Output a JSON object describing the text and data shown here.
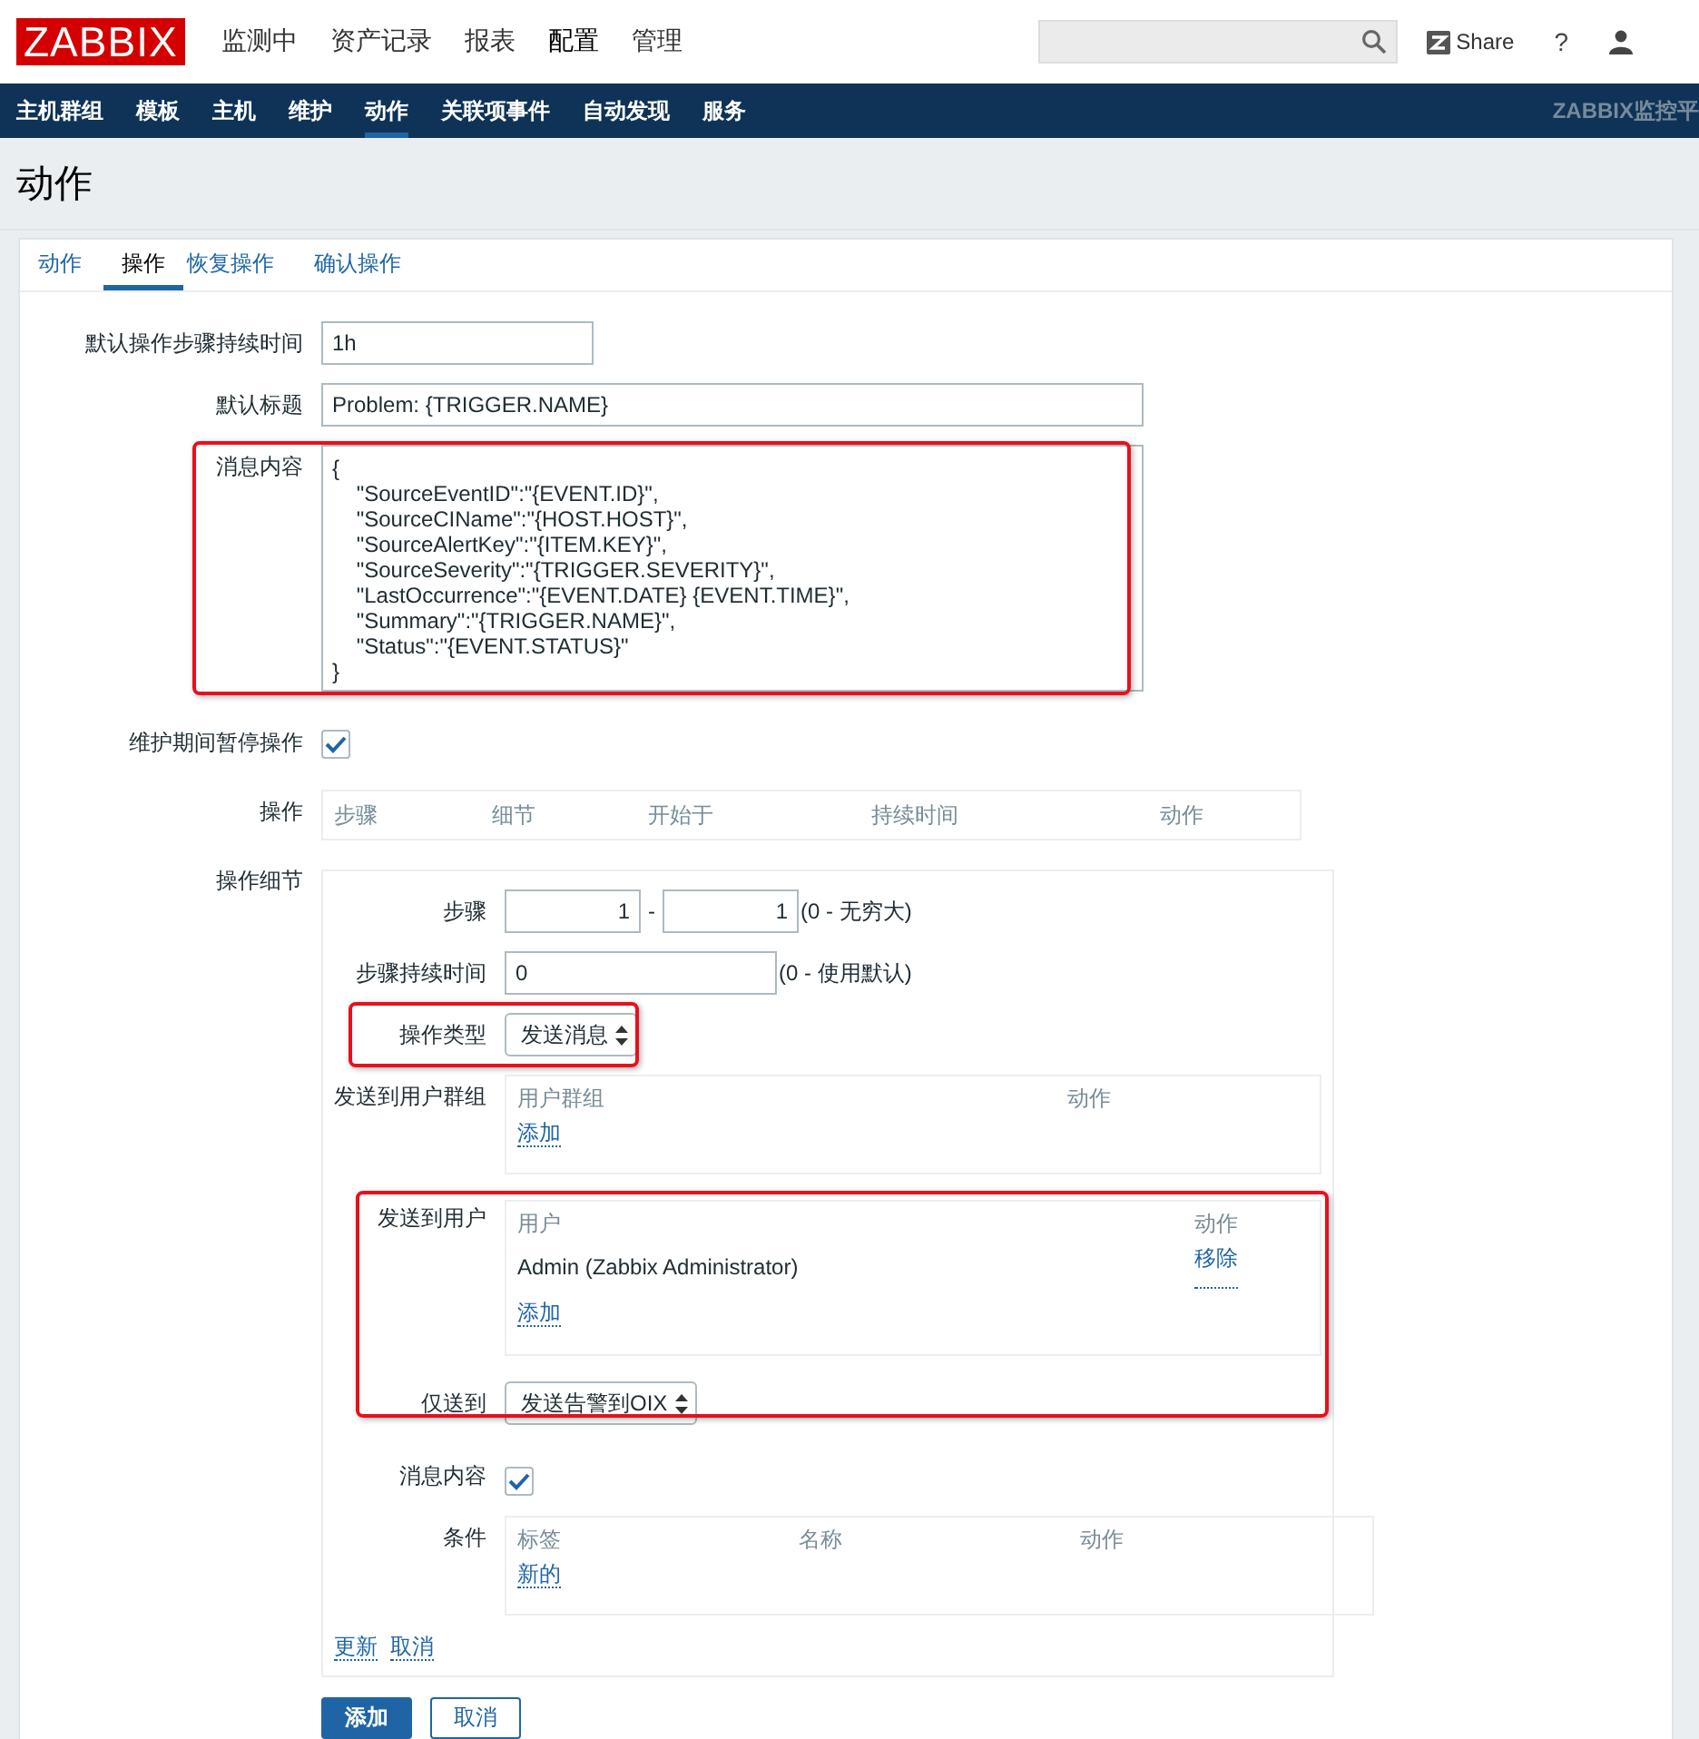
{
  "header": {
    "logo": "ZABBIX",
    "menu": [
      {
        "label": "监测中",
        "selected": false
      },
      {
        "label": "资产记录",
        "selected": false
      },
      {
        "label": "报表",
        "selected": false
      },
      {
        "label": "配置",
        "selected": true
      },
      {
        "label": "管理",
        "selected": false
      }
    ],
    "share": "Share",
    "help": "?"
  },
  "subnav": {
    "items": [
      {
        "label": "主机群组",
        "selected": false
      },
      {
        "label": "模板",
        "selected": false
      },
      {
        "label": "主机",
        "selected": false
      },
      {
        "label": "维护",
        "selected": false
      },
      {
        "label": "动作",
        "selected": true
      },
      {
        "label": "关联项事件",
        "selected": false
      },
      {
        "label": "自动发现",
        "selected": false
      },
      {
        "label": "服务",
        "selected": false
      }
    ],
    "brand": "ZABBIX监控平"
  },
  "page_title": "动作",
  "tabs": [
    {
      "label": "动作",
      "selected": false
    },
    {
      "label": "操作",
      "selected": true
    },
    {
      "label": "恢复操作",
      "selected": false
    },
    {
      "label": "确认操作",
      "selected": false
    }
  ],
  "fields": {
    "duration": {
      "label": "默认操作步骤持续时间",
      "value": "1h"
    },
    "subject": {
      "label": "默认标题",
      "value": "Problem: {TRIGGER.NAME}"
    },
    "message": {
      "label": "消息内容",
      "highlighted": true,
      "value": "{\n    \"SourceEventID\":\"{EVENT.ID}\",\n    \"SourceCIName\":\"{HOST.HOST}\",\n    \"SourceAlertKey\":\"{ITEM.KEY}\",\n    \"SourceSeverity\":\"{TRIGGER.SEVERITY}\",\n    \"LastOccurrence\":\"{EVENT.DATE} {EVENT.TIME}\",\n    \"Summary\":\"{TRIGGER.NAME}\",\n    \"Status\":\"{EVENT.STATUS}\"\n}"
    },
    "pause": {
      "label": "维护期间暂停操作",
      "checked": true
    },
    "operations": {
      "label": "操作",
      "columns": [
        "步骤",
        "细节",
        "开始于",
        "持续时间",
        "动作"
      ]
    }
  },
  "operation_details": {
    "label": "操作细节",
    "steps": {
      "label": "步骤",
      "from": "1",
      "separator": "-",
      "to": "1",
      "hint": "(0 - 无穷大)"
    },
    "step_duration": {
      "label": "步骤持续时间",
      "value": "0",
      "hint": "(0 - 使用默认)"
    },
    "operation_type": {
      "label": "操作类型",
      "value": "发送消息",
      "highlighted": true
    },
    "user_groups": {
      "label": "发送到用户群组",
      "columns": [
        "用户群组",
        "动作"
      ],
      "add_link": "添加"
    },
    "users": {
      "label": "发送到用户",
      "highlighted": true,
      "columns": [
        "用户",
        "动作"
      ],
      "rows": [
        {
          "user": "Admin (Zabbix Administrator)",
          "action": "移除"
        }
      ],
      "add_link": "添加",
      "send_only_label": "仅送到",
      "send_only_value": "发送告警到OIX"
    },
    "default_message": {
      "label": "消息内容",
      "checked": true
    },
    "conditions": {
      "label": "条件",
      "columns": [
        "标签",
        "名称",
        "动作"
      ],
      "add_link": "新的"
    },
    "links": [
      "更新",
      "取消"
    ]
  },
  "buttons": [
    {
      "label": "添加",
      "kind": "primary"
    },
    {
      "label": "取消",
      "kind": "secondary"
    }
  ]
}
